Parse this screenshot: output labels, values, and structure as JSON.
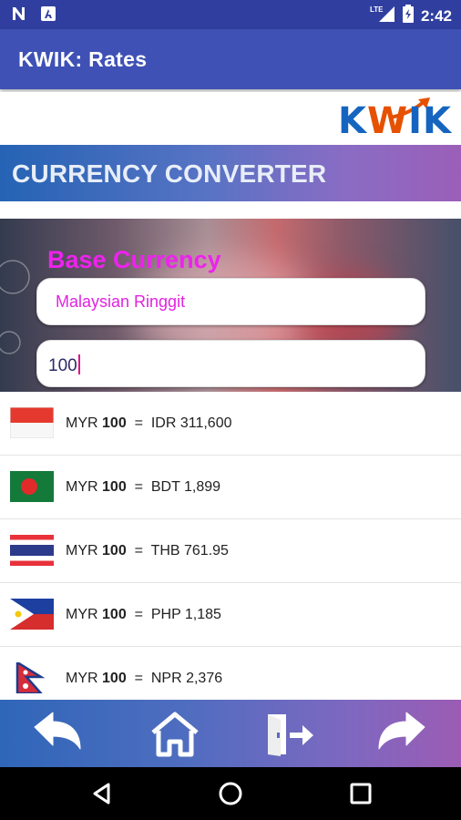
{
  "status_bar": {
    "time": "2:42",
    "icons": [
      "n-notification-icon",
      "a-notification-icon",
      "lte-signal-icon",
      "battery-icon"
    ]
  },
  "app_bar": {
    "title": "KWIK: Rates"
  },
  "logo": {
    "text_k": "K",
    "text_w": "W",
    "text_ik": "IK",
    "colors": {
      "blue": "#1565c0",
      "orange": "#e65100"
    }
  },
  "banner": {
    "title": "CURRENCY CONVERTER"
  },
  "converter": {
    "base_label": "Base Currency",
    "selected_currency": "Malaysian Ringgit",
    "amount": "100"
  },
  "rates": [
    {
      "from": "MYR",
      "amount": "100",
      "eq": "=",
      "to": "IDR 311,600",
      "flag": "indonesia-flag"
    },
    {
      "from": "MYR",
      "amount": "100",
      "eq": "=",
      "to": "BDT 1,899",
      "flag": "bangladesh-flag"
    },
    {
      "from": "MYR",
      "amount": "100",
      "eq": "=",
      "to": "THB 761.95",
      "flag": "thailand-flag"
    },
    {
      "from": "MYR",
      "amount": "100",
      "eq": "=",
      "to": "PHP 1,185",
      "flag": "philippines-flag"
    },
    {
      "from": "MYR",
      "amount": "100",
      "eq": "=",
      "to": "NPR 2,376",
      "flag": "nepal-flag"
    }
  ],
  "bottom_nav": [
    "back-icon",
    "home-icon",
    "exit-icon",
    "forward-icon"
  ],
  "system_nav": [
    "back-triangle-icon",
    "home-circle-icon",
    "recents-square-icon"
  ]
}
